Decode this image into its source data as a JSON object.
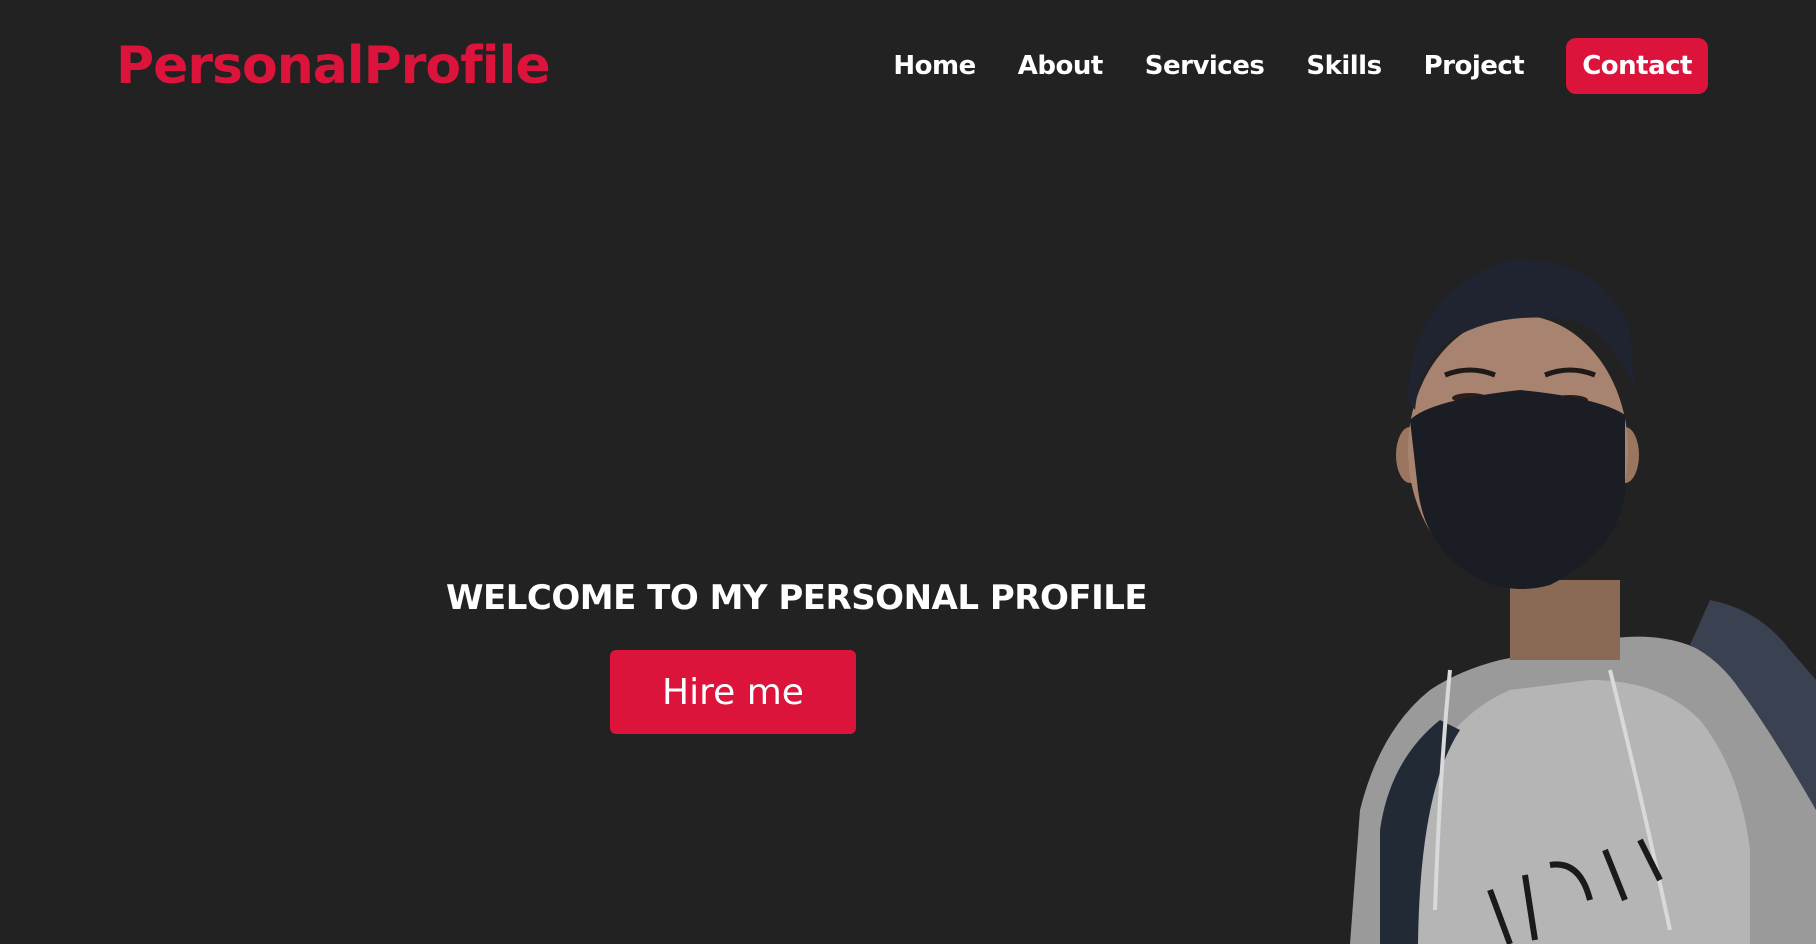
{
  "brand": {
    "name": "PersonalProfile"
  },
  "nav": {
    "items": [
      {
        "label": "Home"
      },
      {
        "label": "About"
      },
      {
        "label": "Services"
      },
      {
        "label": "Skills"
      },
      {
        "label": "Project"
      },
      {
        "label": "Contact",
        "active": true
      }
    ]
  },
  "hero": {
    "title": "WELCOME TO MY PERSONAL PROFILE",
    "button_label": "Hire me"
  },
  "colors": {
    "background": "#222222",
    "accent": "#dc143c",
    "text": "#ffffff"
  },
  "images": {
    "profile_photo": "person-wearing-mask-and-hoodie"
  }
}
